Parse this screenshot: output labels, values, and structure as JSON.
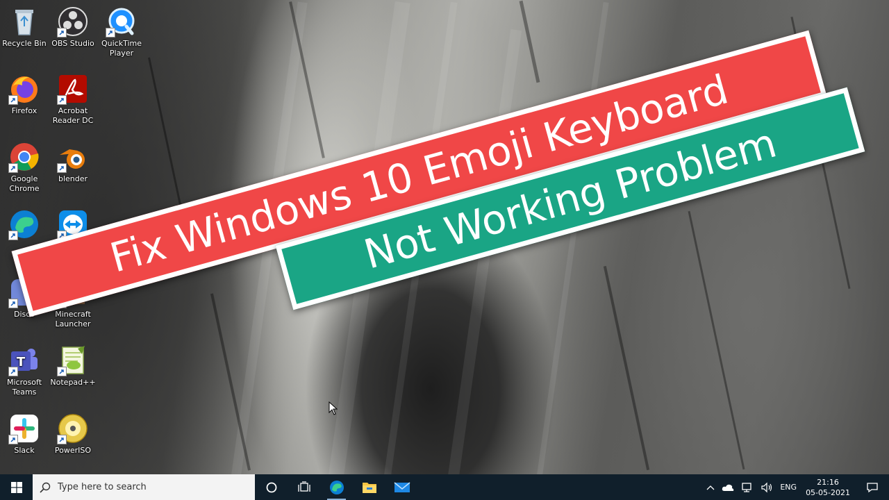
{
  "desktop": {
    "icons": [
      {
        "label": "Recycle Bin",
        "icon": "recycle-bin-icon"
      },
      {
        "label": "OBS Studio",
        "icon": "obs-studio-icon"
      },
      {
        "label": "QuickTime Player",
        "icon": "quicktime-icon"
      },
      {
        "label": "Firefox",
        "icon": "firefox-icon"
      },
      {
        "label": "Acrobat Reader DC",
        "icon": "acrobat-icon"
      },
      {
        "label": "Google Chrome",
        "icon": "chrome-icon"
      },
      {
        "label": "blender",
        "icon": "blender-icon"
      },
      {
        "label": "",
        "icon": "edge-icon"
      },
      {
        "label": "",
        "icon": "teamviewer-icon"
      },
      {
        "label": "Disco",
        "icon": "discord-icon"
      },
      {
        "label": "Minecraft Launcher",
        "icon": "minecraft-icon"
      },
      {
        "label": "Microsoft Teams",
        "icon": "teams-icon"
      },
      {
        "label": "Notepad++",
        "icon": "notepadpp-icon"
      },
      {
        "label": "Slack",
        "icon": "slack-icon"
      },
      {
        "label": "PowerISO",
        "icon": "poweriso-icon"
      }
    ]
  },
  "banners": {
    "line1": "Fix Windows 10 Emoji Keyboard",
    "line2": "Not Working Problem",
    "line1_color": "#f04747",
    "line2_color": "#1aa585"
  },
  "taskbar": {
    "search_placeholder": "Type here to search",
    "language": "ENG",
    "time": "21:16",
    "date": "05-05-2021",
    "apps": [
      "task-view-icon",
      "edge-icon",
      "file-explorer-icon",
      "mail-icon"
    ]
  }
}
